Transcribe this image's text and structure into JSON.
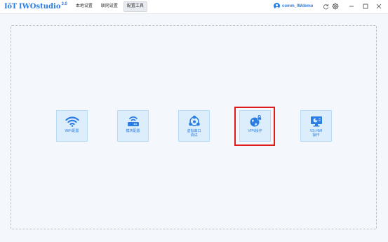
{
  "app": {
    "logo_mark": "IōT",
    "logo_text": "IWOstudio",
    "logo_version": "3.0"
  },
  "menu": {
    "items": [
      {
        "label": "本地设置",
        "active": false
      },
      {
        "label": "联网设置",
        "active": false
      },
      {
        "label": "配置工具",
        "active": true
      }
    ]
  },
  "user": {
    "name": "comm_IWdemo"
  },
  "tiles": [
    {
      "label": "WiFi配置",
      "icon": "wifi-icon"
    },
    {
      "label": "模块配置",
      "icon": "router-icon"
    },
    {
      "label": "虚拟串口\n调试",
      "icon": "virtual-serial-icon"
    },
    {
      "label": "VPN操作",
      "icon": "vpn-globe-lock-icon",
      "selected": true
    },
    {
      "label": "VS-HMI\n操作",
      "icon": "hmi-monitor-icon"
    }
  ],
  "colors": {
    "accent": "#2a7de1",
    "tile_bg": "#dceefc",
    "tile_border": "#b7dcf6",
    "highlight": "#e01b1b",
    "panel_bg": "#f4f7fb"
  }
}
